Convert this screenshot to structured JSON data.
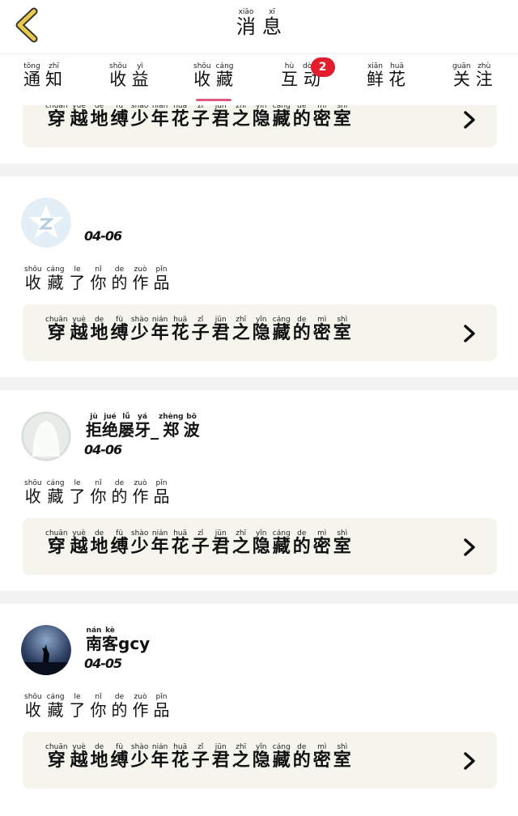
{
  "header": {
    "title_chars": [
      {
        "py": "xiāo",
        "hz": "消"
      },
      {
        "py": "xī",
        "hz": "息"
      }
    ]
  },
  "tabs": [
    {
      "chars": [
        {
          "py": "tōng",
          "hz": "通"
        },
        {
          "py": "zhī",
          "hz": "知"
        }
      ]
    },
    {
      "chars": [
        {
          "py": "shōu",
          "hz": "收"
        },
        {
          "py": "yì",
          "hz": "益"
        }
      ]
    },
    {
      "chars": [
        {
          "py": "shōu",
          "hz": "收"
        },
        {
          "py": "cáng",
          "hz": "藏"
        }
      ]
    },
    {
      "chars": [
        {
          "py": "hù",
          "hz": "互"
        },
        {
          "py": "dòng",
          "hz": "动"
        }
      ],
      "badge": "2"
    },
    {
      "chars": [
        {
          "py": "xiān",
          "hz": "鲜"
        },
        {
          "py": "huā",
          "hz": "花"
        }
      ]
    },
    {
      "chars": [
        {
          "py": "guān",
          "hz": "关"
        },
        {
          "py": "zhù",
          "hz": "注"
        }
      ]
    }
  ],
  "work_title_chars": [
    {
      "py": "chuān",
      "hz": "穿"
    },
    {
      "py": "yuè",
      "hz": "越"
    },
    {
      "py": "de",
      "hz": "地"
    },
    {
      "py": "fù",
      "hz": "缚"
    },
    {
      "py": "shào",
      "hz": "少"
    },
    {
      "py": "nián",
      "hz": "年"
    },
    {
      "py": "huā",
      "hz": "花"
    },
    {
      "py": "zǐ",
      "hz": "子"
    },
    {
      "py": "jūn",
      "hz": "君"
    },
    {
      "py": "zhī",
      "hz": "之"
    },
    {
      "py": "yǐn",
      "hz": "隐"
    },
    {
      "py": "cáng",
      "hz": "藏"
    },
    {
      "py": "de",
      "hz": "的"
    },
    {
      "py": "mì",
      "hz": "密"
    },
    {
      "py": "shì",
      "hz": "室"
    }
  ],
  "action_chars": [
    {
      "py": "shōu",
      "hz": "收"
    },
    {
      "py": "cáng",
      "hz": "藏"
    },
    {
      "py": "le",
      "hz": "了"
    },
    {
      "py": "nǐ",
      "hz": "你"
    },
    {
      "py": "de",
      "hz": "的"
    },
    {
      "py": "zuò",
      "hz": "作"
    },
    {
      "py": "pǐn",
      "hz": "品"
    }
  ],
  "notifications": [
    {
      "user_chars": [],
      "date": "04-06",
      "avatar": "qzone-avatar"
    },
    {
      "user_chars": [
        {
          "py": "jù",
          "hz": "拒"
        },
        {
          "py": "jué",
          "hz": "绝"
        },
        {
          "py": "lǚ",
          "hz": "屡"
        },
        {
          "py": "yá",
          "hz": "牙"
        },
        {
          "py": "",
          "hz": "_"
        },
        {
          "py": "zhèng",
          "hz": "郑"
        },
        {
          "py": "bō",
          "hz": "波"
        }
      ],
      "date": "04-06",
      "avatar": "default-avatar"
    },
    {
      "user_chars": [
        {
          "py": "nán",
          "hz": "南"
        },
        {
          "py": "kè",
          "hz": "客"
        },
        {
          "py": "",
          "hz": "gcy"
        }
      ],
      "date": "04-05",
      "avatar": "wolf-avatar"
    }
  ],
  "colors": {
    "accent": "#e05a80",
    "badge": "#e21d2e",
    "back_arrow": "#e8c94a",
    "work_bg": "#f5f5ee"
  }
}
